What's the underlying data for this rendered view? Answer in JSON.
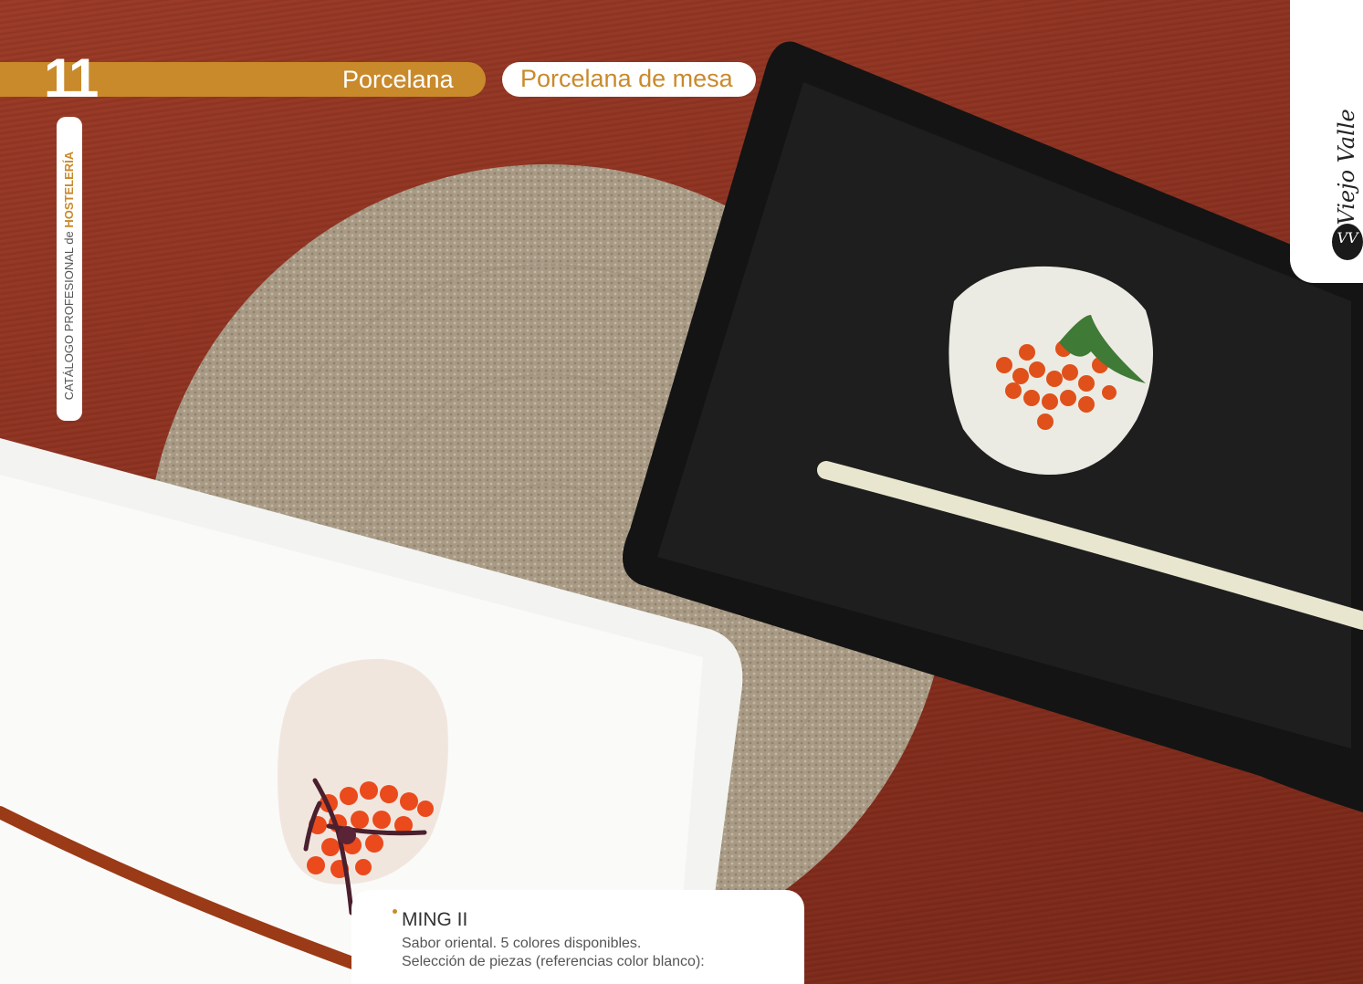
{
  "header": {
    "chapter_number": "11",
    "section": "Porcelana",
    "subsection": "Porcelana de mesa"
  },
  "side_label": {
    "prefix": "CATÁLOGO PROFESIONAL de ",
    "emphasis": "HOSTELERÍA"
  },
  "brand": {
    "name": "Viejo Valle",
    "logo_text": "VV"
  },
  "product": {
    "name": "MING II",
    "description_lines": [
      "Sabor oriental. 5 colores disponibles.",
      "Selección de piezas (referencias color blanco):"
    ]
  },
  "colors": {
    "accent": "#c98a2b",
    "wood": "#8a3020",
    "white_plate": "#f3f3f1",
    "black_plate": "#151515"
  }
}
